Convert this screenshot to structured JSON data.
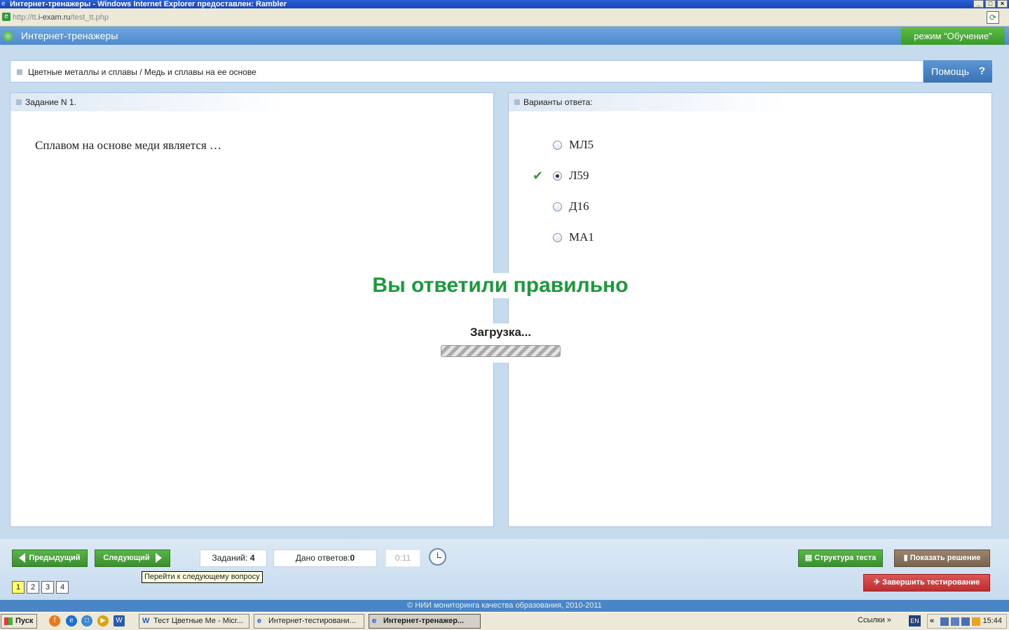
{
  "window": {
    "title": "Интернет-тренажеры - Windows Internet Explorer предоставлен: Rambler",
    "url_prefix": "http://tt.",
    "url_host": "i-exam.ru",
    "url_path": "/test_tt.php"
  },
  "app": {
    "title": "Интернет-тренажеры",
    "mode": "режим \"Обучение\""
  },
  "breadcrumb": "Цветные металлы и сплавы / Медь и сплавы на ее основе",
  "help_label": "Помощь",
  "help_icon": "?",
  "task_panel": {
    "header": "Задание N 1.",
    "question": "Сплавом на основе меди является …"
  },
  "answers_panel": {
    "header": "Варианты ответа:",
    "options": [
      {
        "label": "МЛ5",
        "selected": false
      },
      {
        "label": "Л59",
        "selected": true,
        "correct": true
      },
      {
        "label": "Д16",
        "selected": false
      },
      {
        "label": "МА1",
        "selected": false
      }
    ]
  },
  "result_text": "Вы ответили правильно",
  "loading_text": "Загрузка...",
  "footer": {
    "prev_label": "Предыдущий",
    "next_label": "Следующий",
    "tasks_label": "Заданий:",
    "tasks_count": "4",
    "answers_label": "Дано ответов:",
    "answers_count": "0",
    "timer": "0:11",
    "next_tooltip": "Перейти к следующему вопросу",
    "pages": [
      "1",
      "2",
      "3",
      "4"
    ],
    "current_page": "1",
    "structure_label": "Структура теста",
    "solution_label": "Показать решение",
    "finish_label": "Завершить тестирование",
    "copyright": "© НИИ мониторинга качества образования, 2010-2011"
  },
  "taskbar": {
    "start": "Пуск",
    "tasks": [
      "Тест Цветные Ме - Micr...",
      "Интернет-тестировани...",
      "Интернет-тренажер..."
    ],
    "links": "Ссылки",
    "lang": "EN",
    "clock": "15:44"
  },
  "colors": {
    "correct": "#1a9a38",
    "header_blue": "#4e8bcf",
    "button_green": "#3a8f2d"
  }
}
